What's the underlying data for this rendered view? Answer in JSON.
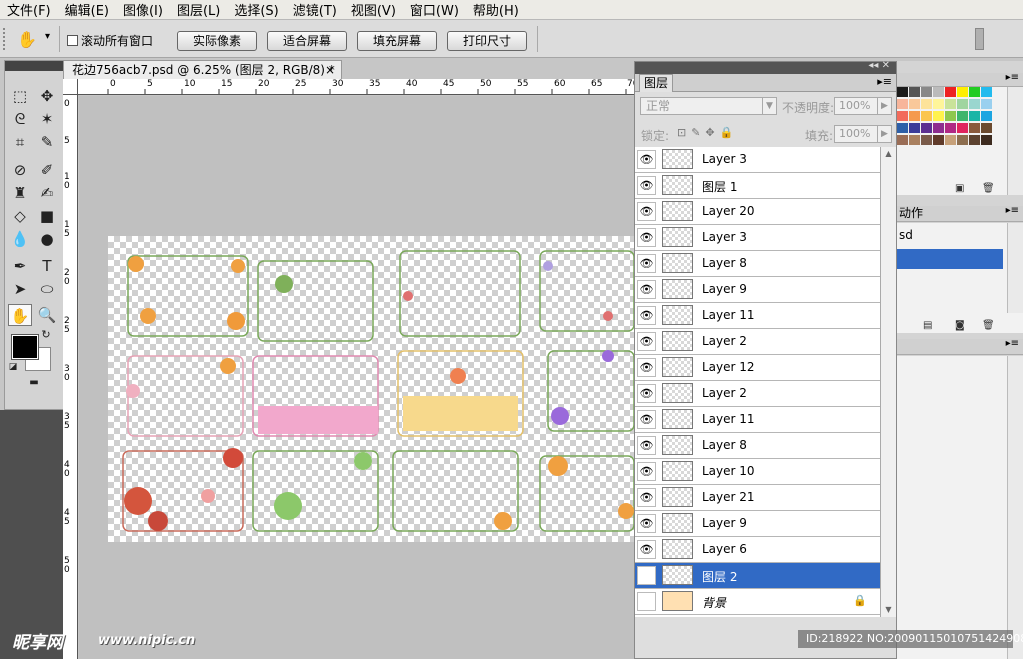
{
  "menubar": {
    "items": [
      "文件(F)",
      "编辑(E)",
      "图像(I)",
      "图层(L)",
      "选择(S)",
      "滤镜(T)",
      "视图(V)",
      "窗口(W)",
      "帮助(H)"
    ]
  },
  "options": {
    "scroll_all_label": "滚动所有窗口",
    "buttons": [
      "实际像素",
      "适合屏幕",
      "填充屏幕",
      "打印尺寸"
    ]
  },
  "document": {
    "tab_title": "花边756acb7.psd @ 6.25% (图层 2, RGB/8) *",
    "close_glyph": "×",
    "h_ruler": [
      "0",
      "5",
      "10",
      "15",
      "20",
      "25",
      "30",
      "35",
      "40",
      "45",
      "50",
      "55",
      "60",
      "65",
      "70"
    ],
    "v_ruler": [
      "0",
      "5",
      "1 0",
      "1 5",
      "2 0",
      "2 5",
      "3 0",
      "3 5",
      "4 0",
      "4 5",
      "5 0"
    ]
  },
  "layers_panel": {
    "tab_label": "图层",
    "blend_mode": "正常",
    "opacity_label": "不透明度:",
    "opacity_value": "100%",
    "lock_label": "锁定:",
    "fill_label": "填充:",
    "fill_value": "100%",
    "layers": [
      {
        "name": "Layer 3",
        "visible": true
      },
      {
        "name": "图层 1",
        "visible": true
      },
      {
        "name": "Layer 20",
        "visible": true
      },
      {
        "name": "Layer 3",
        "visible": true
      },
      {
        "name": "Layer 8",
        "visible": true
      },
      {
        "name": "Layer 9",
        "visible": true
      },
      {
        "name": "Layer 11",
        "visible": true
      },
      {
        "name": "Layer 2",
        "visible": true
      },
      {
        "name": "Layer 12",
        "visible": true
      },
      {
        "name": "Layer 2",
        "visible": true
      },
      {
        "name": "Layer 11",
        "visible": true
      },
      {
        "name": "Layer 8",
        "visible": true
      },
      {
        "name": "Layer 10",
        "visible": true
      },
      {
        "name": "Layer 21",
        "visible": true
      },
      {
        "name": "Layer 9",
        "visible": true
      },
      {
        "name": "Layer 6",
        "visible": true
      },
      {
        "name": "图层 2",
        "visible": false,
        "selected": true
      },
      {
        "name": "背景",
        "visible": false,
        "locked": true
      }
    ]
  },
  "right_panel": {
    "actions_tab": "动作",
    "history_item": "sd"
  },
  "watermark": {
    "logo": "昵享网",
    "url": "www.nipic.cn",
    "id_text": "ID:218922 NO:20090115010751424908"
  },
  "colors": {
    "selection": "#316ac5",
    "panel_bg": "#dedede",
    "canvas_bg": "#c0c0c0"
  }
}
